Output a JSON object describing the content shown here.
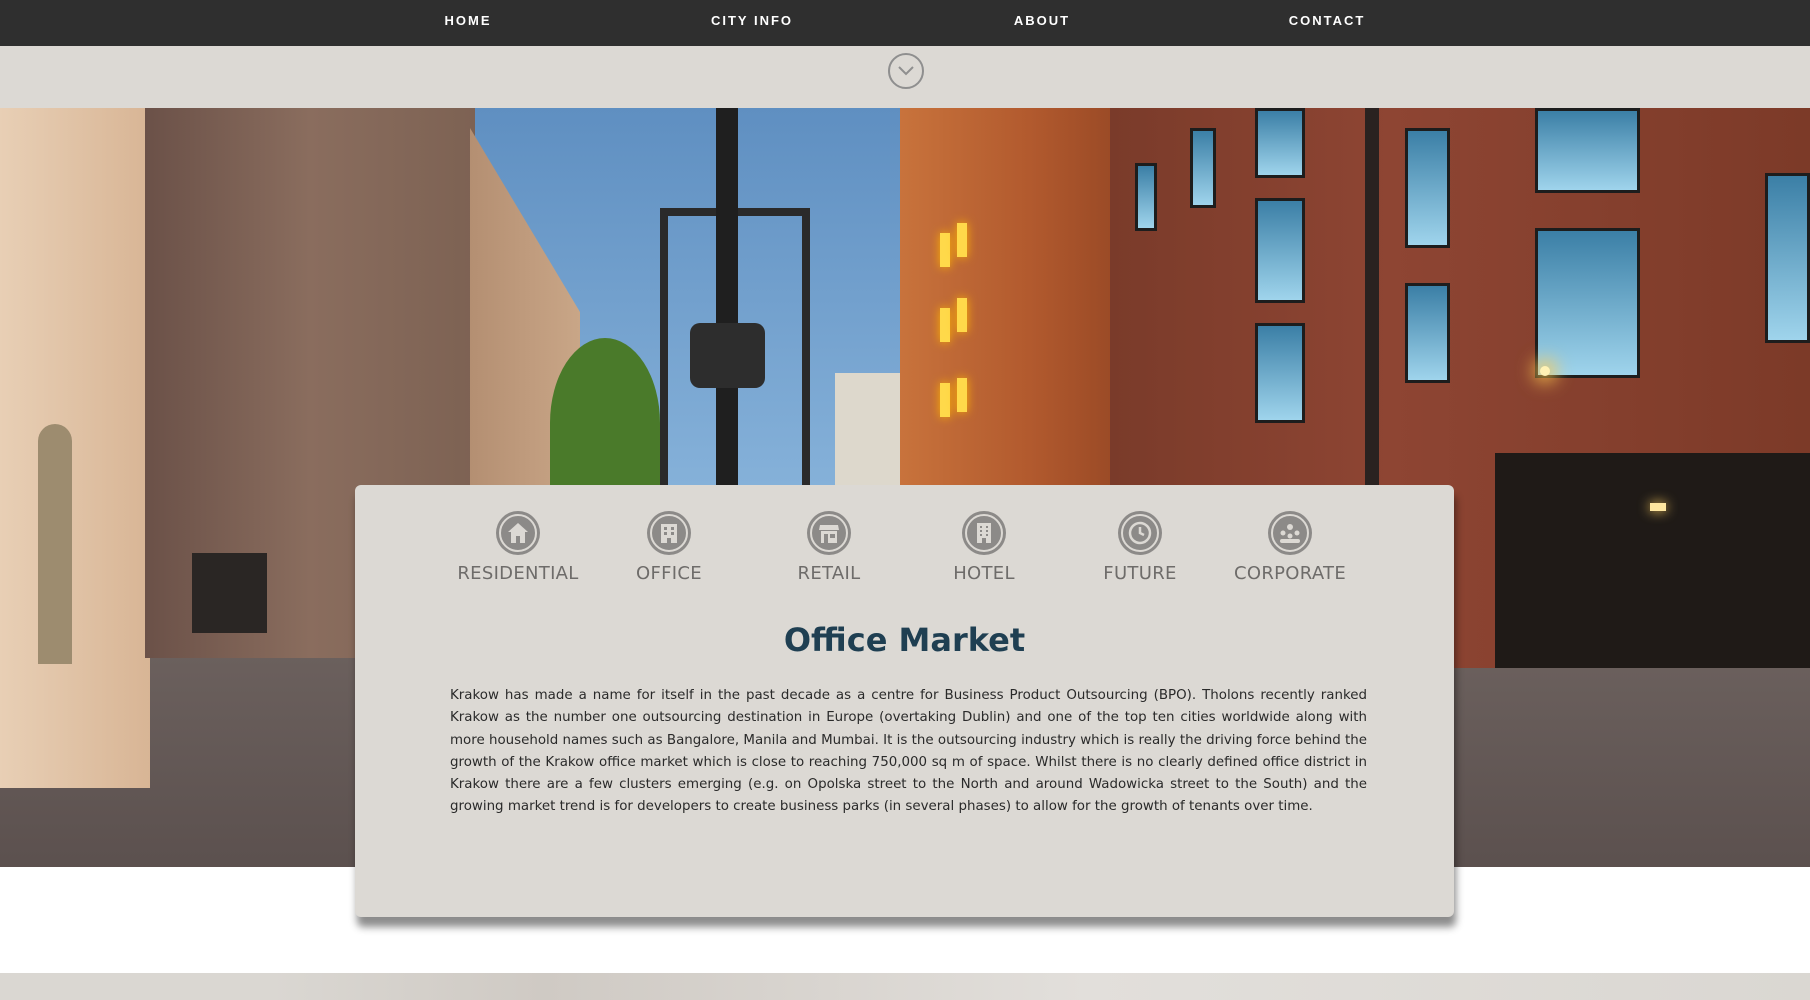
{
  "nav": {
    "items": [
      "HOME",
      "CITY INFO",
      "ABOUT",
      "CONTACT"
    ]
  },
  "scroll": {
    "icon": "chevron-down-circle-icon"
  },
  "categories": [
    {
      "label": "RESIDENTIAL",
      "icon": "house-icon"
    },
    {
      "label": "OFFICE",
      "icon": "office-building-icon"
    },
    {
      "label": "RETAIL",
      "icon": "storefront-icon"
    },
    {
      "label": "HOTEL",
      "icon": "hotel-icon"
    },
    {
      "label": "FUTURE",
      "icon": "clock-icon"
    },
    {
      "label": "CORPORATE",
      "icon": "people-icon"
    }
  ],
  "main": {
    "title": "Office Market",
    "body": "Krakow has made a name for itself in the past decade as a centre for Business Product Outsourcing (BPO). Tholons recently ranked Krakow as the number one outsourcing destination in Europe (overtaking Dublin) and one of the top ten cities worldwide along with more household names such as Bangalore, Manila and Mumbai. It is the outsourcing industry which is really the driving force behind the growth of the Krakow office market which is close to reaching 750,000 sq m of space. Whilst there is no clearly defined office district in Krakow there are a few clusters emerging (e.g. on Opolska street to the North and around Wadowicka street to the South) and the growing market trend is for developers to create business parks (in several phases) to allow for the growth of tenants over time."
  },
  "colors": {
    "nav_bg": "#2f2f2f",
    "band_bg": "#dcd9d4",
    "card_bg": "#dcd9d4",
    "title": "#1f3f52",
    "icon": "#8c8a88"
  }
}
